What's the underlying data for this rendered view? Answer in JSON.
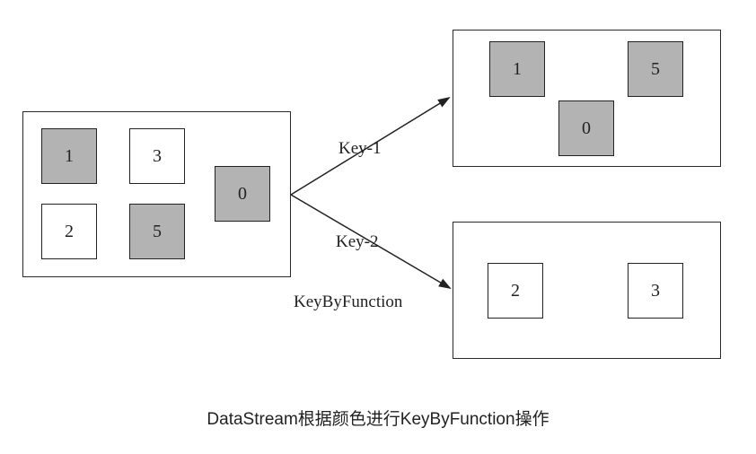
{
  "source": {
    "items": [
      {
        "value": "1",
        "color": "gray"
      },
      {
        "value": "3",
        "color": "white"
      },
      {
        "value": "2",
        "color": "white"
      },
      {
        "value": "5",
        "color": "gray"
      },
      {
        "value": "0",
        "color": "gray"
      }
    ]
  },
  "group1": {
    "items": [
      {
        "value": "1",
        "color": "gray"
      },
      {
        "value": "5",
        "color": "gray"
      },
      {
        "value": "0",
        "color": "gray"
      }
    ]
  },
  "group2": {
    "items": [
      {
        "value": "2",
        "color": "white"
      },
      {
        "value": "3",
        "color": "white"
      }
    ]
  },
  "labels": {
    "key1": "Key-1",
    "key2": "Key-2",
    "function": "KeyByFunction"
  },
  "caption": "DataStream根据颜色进行KeyByFunction操作",
  "colors": {
    "gray": "#b3b3b3",
    "white": "#ffffff",
    "stroke": "#222222"
  }
}
